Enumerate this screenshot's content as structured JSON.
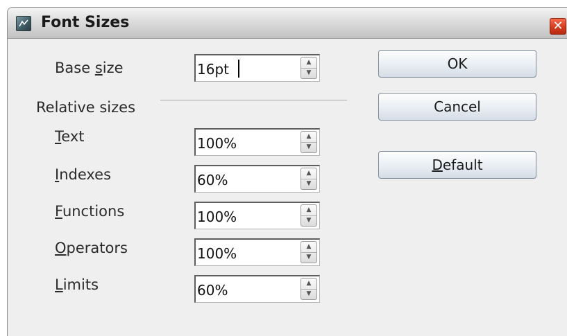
{
  "window": {
    "title": "Font Sizes",
    "close_symbol": "✕",
    "icon": "math-app-icon"
  },
  "base_size": {
    "label_pre": "Base ",
    "label_mnemonic": "s",
    "label_post": "ize",
    "value": "16pt"
  },
  "relative_sizes_heading": "Relative sizes",
  "rows": [
    {
      "label_pre": "",
      "mnemonic": "T",
      "label_post": "ext",
      "value": "100%"
    },
    {
      "label_pre": "",
      "mnemonic": "I",
      "label_post": "ndexes",
      "value": "60%"
    },
    {
      "label_pre": "",
      "mnemonic": "F",
      "label_post": "unctions",
      "value": "100%"
    },
    {
      "label_pre": "",
      "mnemonic": "O",
      "label_post": "perators",
      "value": "100%"
    },
    {
      "label_pre": "",
      "mnemonic": "L",
      "label_post": "imits",
      "value": "60%"
    }
  ],
  "buttons": {
    "ok": "OK",
    "cancel": "Cancel",
    "default_mnemonic": "D",
    "default_rest": "efault"
  },
  "spin_arrows": {
    "up": "▲",
    "down": "▼"
  }
}
